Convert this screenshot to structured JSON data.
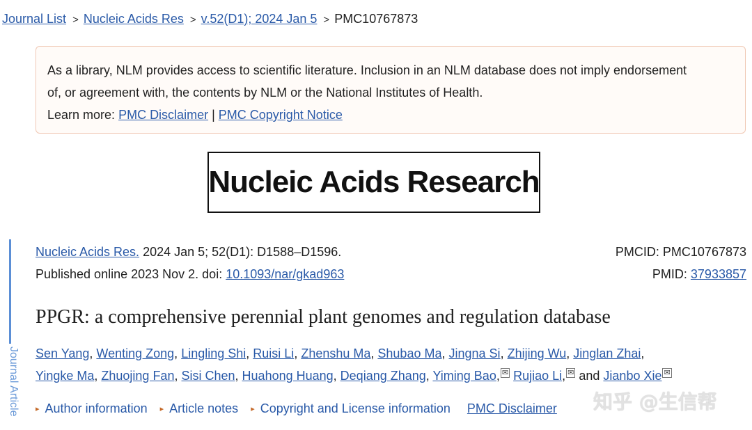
{
  "breadcrumb": {
    "journal_list": "Journal List",
    "journal": "Nucleic Acids Res",
    "issue": "v.52(D1); 2024 Jan 5",
    "current": "PMC10767873",
    "separator": ">"
  },
  "notice": {
    "line1": "As a library, NLM provides access to scientific literature. Inclusion in an NLM database does not imply endorsement",
    "line2": "of, or agreement with, the contents by NLM or the National Institutes of Health.",
    "learn_more": "Learn more: ",
    "disclaimer_link": "PMC Disclaimer",
    "divider": " | ",
    "copyright_link": "PMC Copyright Notice"
  },
  "banner": {
    "journal_name": "Nucleic Acids Research"
  },
  "side_label": "Journal Article",
  "citation": {
    "journal_link": "Nucleic Acids Res.",
    "details": " 2024 Jan 5; 52(D1): D1588–D1596.",
    "published": "Published online 2023 Nov 2. doi: ",
    "doi_link": "10.1093/nar/gkad963",
    "pmcid": "PMCID: PMC10767873",
    "pmid_label": "PMID: ",
    "pmid_link": "37933857"
  },
  "title": "PPGR: a comprehensive perennial plant genomes and regulation database",
  "authors": {
    "row1": [
      "Sen Yang",
      "Wenting Zong",
      "Lingling Shi",
      "Ruisi Li",
      "Zhenshu Ma",
      "Shubao Ma",
      "Jingna Si",
      "Zhijing Wu",
      "Jinglan Zhai"
    ],
    "row2": [
      "Yingke Ma",
      "Zhuojing Fan",
      "Sisi Chen",
      "Huahong Huang",
      "Deqiang Zhang",
      "Yiming Bao"
    ],
    "rujiao": "Rujiao Li",
    "and": " and ",
    "jianbo": "Jianbo Xie",
    "mail_glyph": "✉"
  },
  "expanders": {
    "author_info": "Author information",
    "article_notes": "Article notes",
    "copyright_info": "Copyright and License information",
    "pmc_disclaimer": "PMC Disclaimer",
    "triangle": "▸"
  },
  "watermark": "知乎 @生信帮",
  "colors": {
    "link": "#2a5aa8",
    "notice_border": "#f0c8b4",
    "side_accent": "#5b8fd6"
  }
}
